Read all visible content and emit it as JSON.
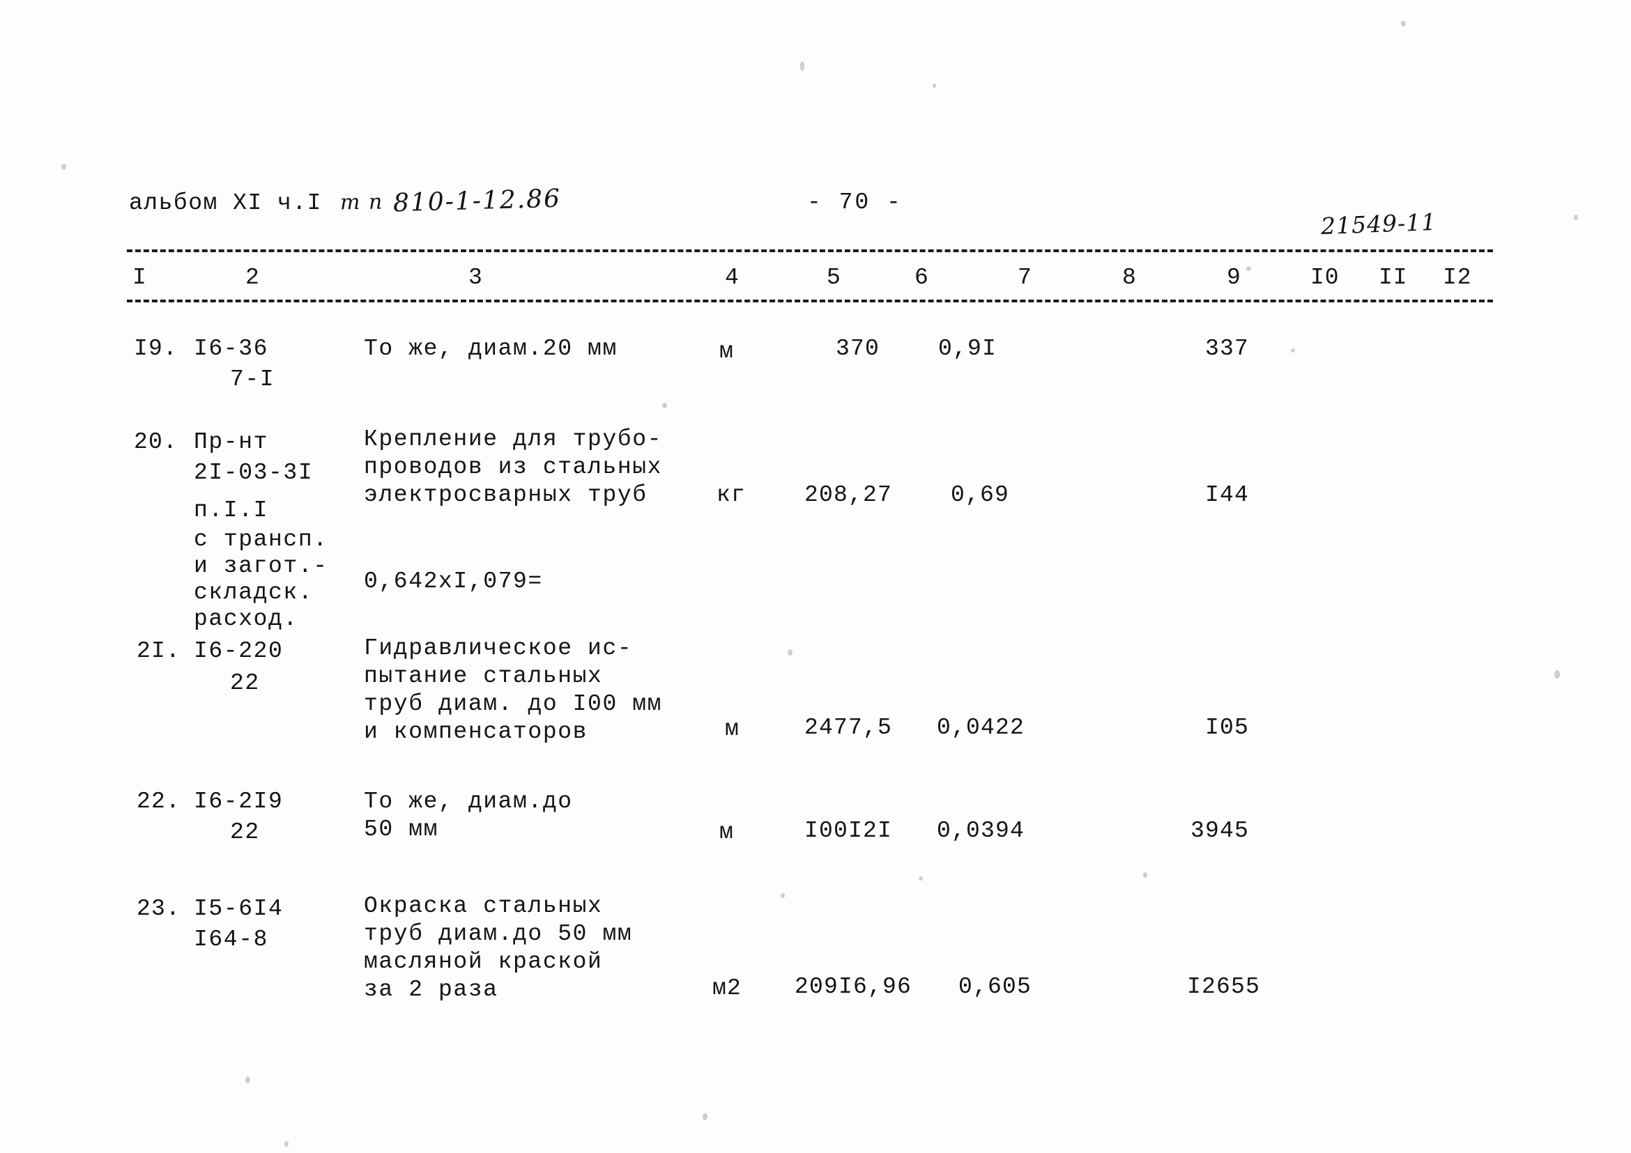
{
  "header": {
    "album_label": "альбом XI ч.I",
    "tp_label": "т п",
    "doc_code": "810-1-12.86",
    "page_number": "- 70 -",
    "stamp_number": "21549-11"
  },
  "table": {
    "column_headers": [
      "I",
      "2",
      "3",
      "4",
      "5",
      "6",
      "7",
      "8",
      "9",
      "I0",
      "II",
      "I2"
    ],
    "rows": [
      {
        "index": "I9.",
        "code_lines": [
          "I6-36",
          "7-I"
        ],
        "description_lines": [
          "То же, диам.20 мм"
        ],
        "unit": "м",
        "quantity": "370",
        "rate": "0,9I",
        "total": "337"
      },
      {
        "index": "20.",
        "code_lines": [
          "Пр-нт",
          "2I-03-3I",
          "п.I.I",
          "с трансп.",
          "и загот.-",
          "складск.",
          "расход."
        ],
        "description_lines": [
          "Крепление для трубо-",
          "проводов из стальных",
          "электросварных труб"
        ],
        "formula": "0,642xI,079=",
        "unit": "кг",
        "quantity": "208,27",
        "rate": "0,69",
        "total": "I44"
      },
      {
        "index": "2I.",
        "code_lines": [
          "I6-220",
          "22"
        ],
        "description_lines": [
          "Гидравлическое ис-",
          "пытание стальных",
          "труб диам. до I00 мм",
          "и компенсаторов"
        ],
        "unit": "м",
        "quantity": "2477,5",
        "rate": "0,0422",
        "total": "I05"
      },
      {
        "index": "22.",
        "code_lines": [
          "I6-2I9",
          "22"
        ],
        "description_lines": [
          "То же, диам.до",
          "50 мм"
        ],
        "unit": "м",
        "quantity": "I00I2I",
        "rate": "0,0394",
        "total": "3945"
      },
      {
        "index": "23.",
        "code_lines": [
          "I5-6I4",
          "I64-8"
        ],
        "description_lines": [
          "Окраска стальных",
          "труб диам.до 50 мм",
          "масляной краской",
          "за 2 раза"
        ],
        "unit": "м2",
        "quantity": "209I6,96",
        "rate": "0,605",
        "total": "I2655"
      }
    ]
  }
}
